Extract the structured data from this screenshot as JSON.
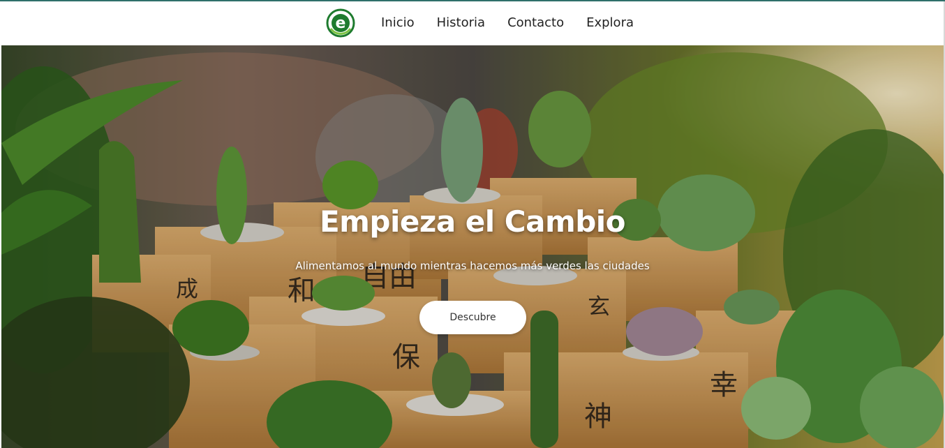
{
  "nav": {
    "brand_letter": "e",
    "items": [
      {
        "label": "Inicio"
      },
      {
        "label": "Historia"
      },
      {
        "label": "Contacto"
      },
      {
        "label": "Explora"
      }
    ]
  },
  "hero": {
    "title": "Empieza el Cambio",
    "subtitle": "Alimentamos al mundo mientras hacemos más verdes las ciudades",
    "cta_label": "Descubre"
  },
  "colors": {
    "brand_green": "#1e7b2e",
    "accent_line": "#2f6f6a",
    "button_bg": "#ffffff"
  }
}
